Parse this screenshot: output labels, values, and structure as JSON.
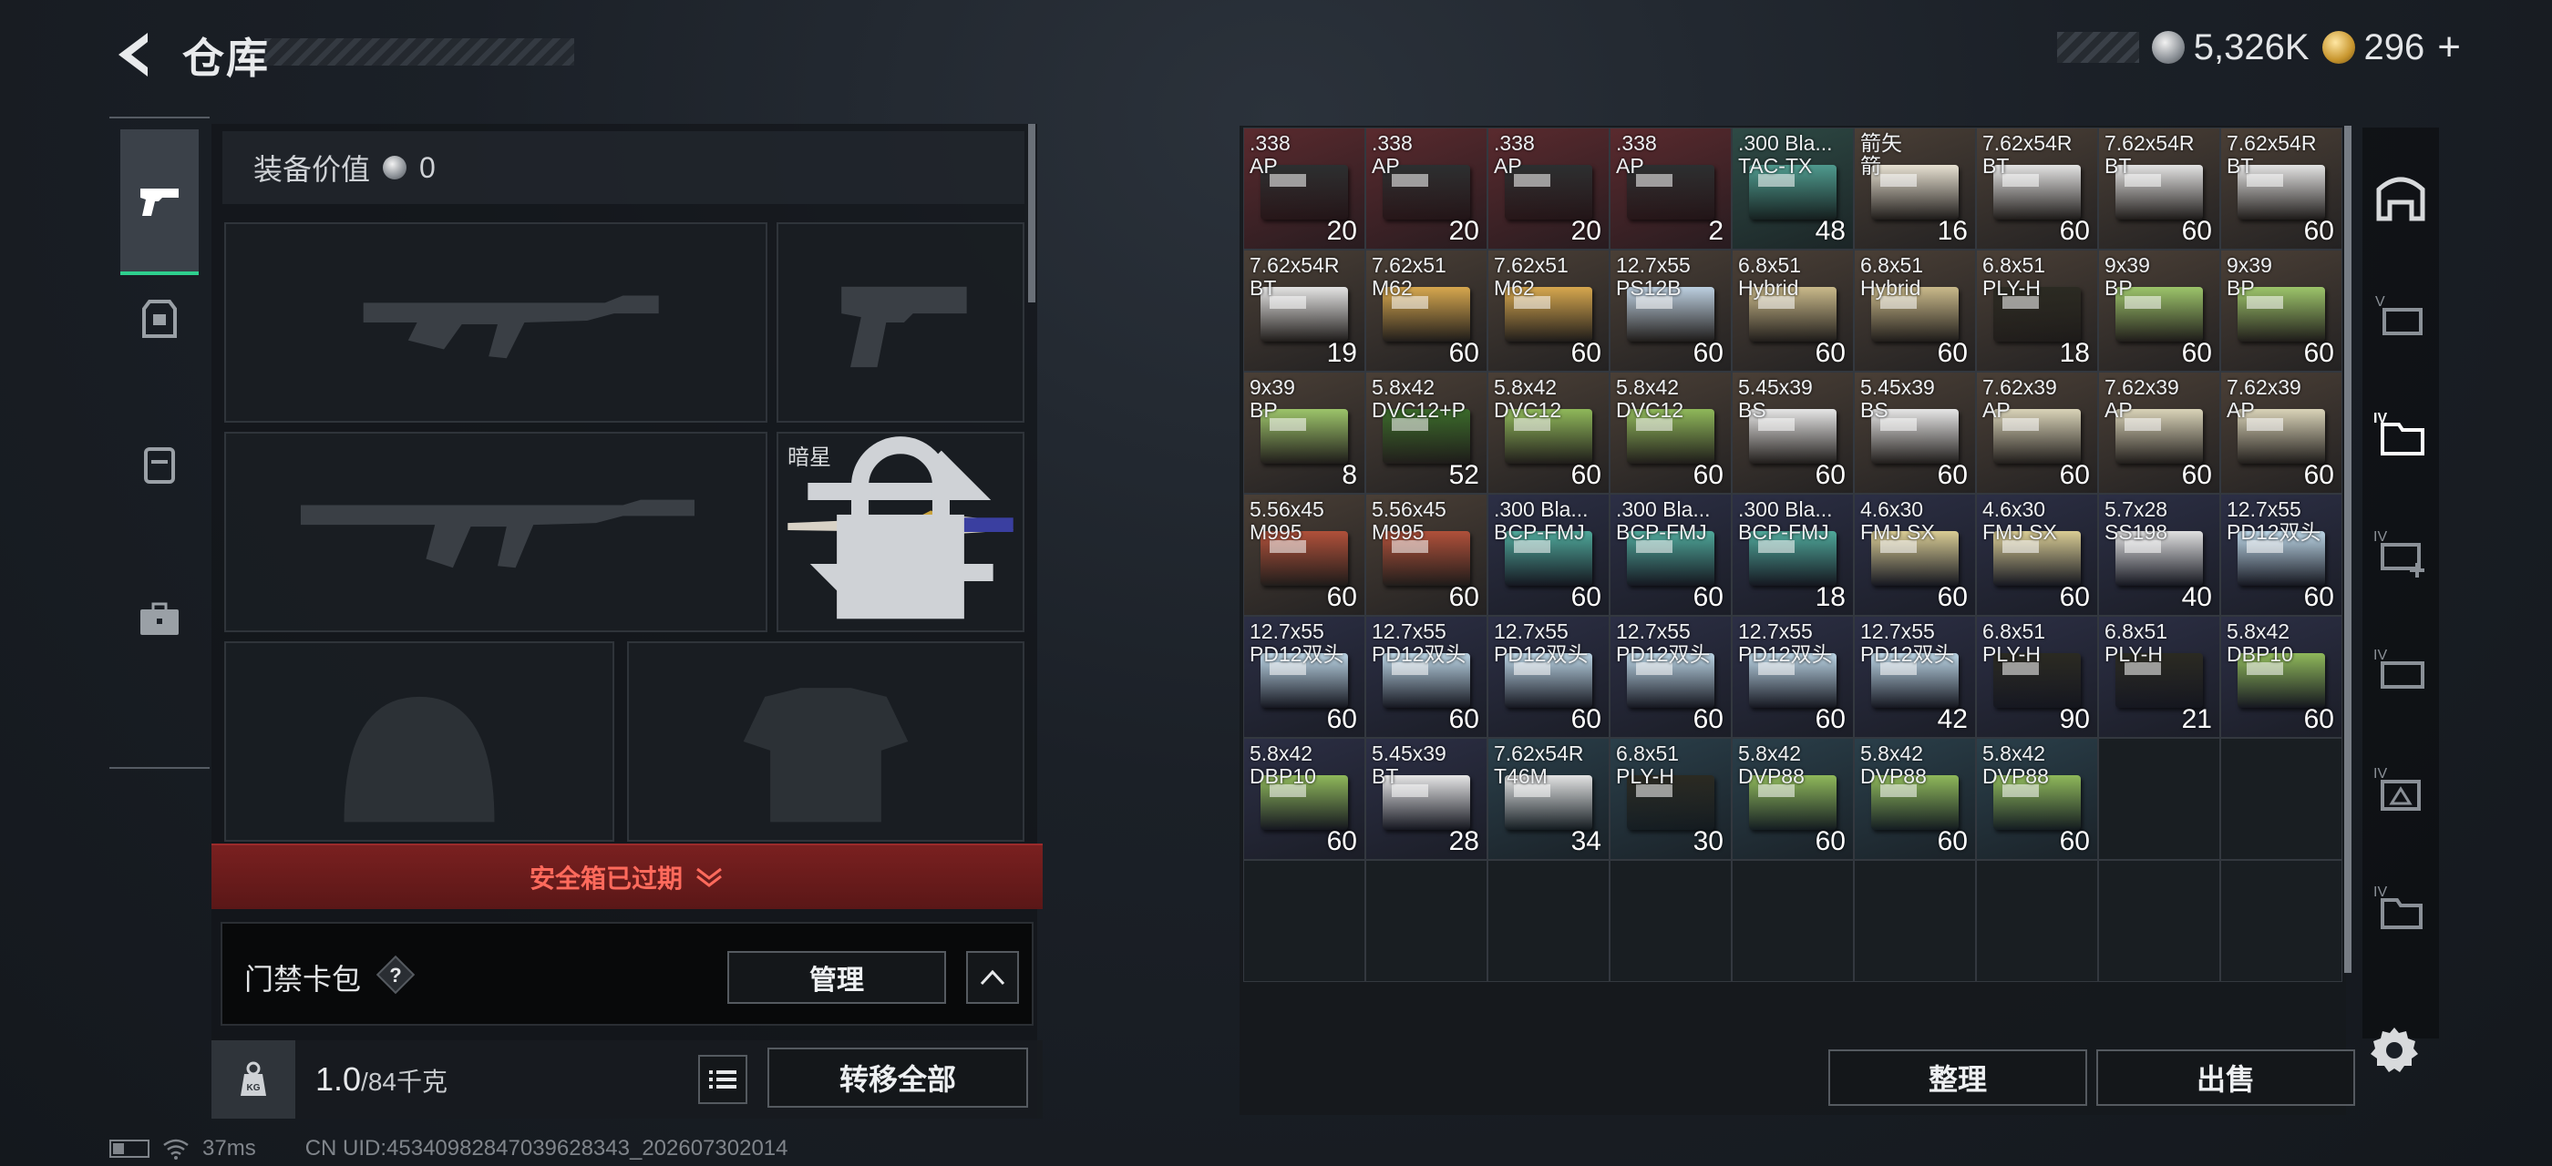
{
  "header": {
    "title": "仓库",
    "currency": {
      "silver": "5,326K",
      "gold": "296"
    }
  },
  "loadout": {
    "equip_value_label": "装备价值",
    "equip_value": "0",
    "knife_name": "暗星",
    "safe_box_expired": "安全箱已过期",
    "keycard_label": "门禁卡包",
    "help_symbol": "?",
    "manage_label": "管理",
    "weight_value": "1.0",
    "weight_capacity": "/84千克",
    "kg_badge": "KG",
    "transfer_all_label": "转移全部"
  },
  "storage": {
    "sort_label": "整理",
    "sell_label": "出售",
    "items": [
      {
        "name": ".338\nAP",
        "qty": "20",
        "bg": "#5a2a2e",
        "box": "#2c2f30"
      },
      {
        "name": ".338\nAP",
        "qty": "20",
        "bg": "#5a2a2e",
        "box": "#2c2f30"
      },
      {
        "name": ".338\nAP",
        "qty": "20",
        "bg": "#5a2a2e",
        "box": "#2c2f30"
      },
      {
        "name": ".338\nAP",
        "qty": "2",
        "bg": "#5a2a2e",
        "box": "#2c2f30"
      },
      {
        "name": ".300 Bla...\nTAC-TX",
        "qty": "48",
        "bg": "#2e4a45",
        "box": "#4f9a8e"
      },
      {
        "name": "箭矢\n箭",
        "qty": "16",
        "bg": "#4a3f36",
        "box": "#e7e1d2"
      },
      {
        "name": "7.62x54R\nBT",
        "qty": "60",
        "bg": "#4a3f36",
        "box": "#e3e3e3"
      },
      {
        "name": "7.62x54R\nBT",
        "qty": "60",
        "bg": "#4a3f36",
        "box": "#e3e3e3"
      },
      {
        "name": "7.62x54R\nBT",
        "qty": "60",
        "bg": "#4a3f36",
        "box": "#e3e3e3"
      },
      {
        "name": "7.62x54R\nBT",
        "qty": "19",
        "bg": "#4a3f36",
        "box": "#e3e3e3"
      },
      {
        "name": "7.62x51\nM62",
        "qty": "60",
        "bg": "#4a3f36",
        "box": "#d6a74e"
      },
      {
        "name": "7.62x51\nM62",
        "qty": "60",
        "bg": "#4a3f36",
        "box": "#d6a74e"
      },
      {
        "name": "12.7x55\nPS12B",
        "qty": "60",
        "bg": "#4a3f36",
        "box": "#bccfe0"
      },
      {
        "name": "6.8x51\nHybrid",
        "qty": "60",
        "bg": "#4a3f36",
        "box": "#c9b98a"
      },
      {
        "name": "6.8x51\nHybrid",
        "qty": "60",
        "bg": "#4a3f36",
        "box": "#c9b98a"
      },
      {
        "name": "6.8x51\nPLY-H",
        "qty": "18",
        "bg": "#4a3f36",
        "box": "#2b2a22"
      },
      {
        "name": "9x39\nBP",
        "qty": "60",
        "bg": "#4a3f36",
        "box": "#9cc46a"
      },
      {
        "name": "9x39\nBP",
        "qty": "60",
        "bg": "#4a3f36",
        "box": "#9cc46a"
      },
      {
        "name": "9x39\nBP",
        "qty": "8",
        "bg": "#4a3f36",
        "box": "#9cc46a"
      },
      {
        "name": "5.8x42\nDVC12+P",
        "qty": "52",
        "bg": "#4a3f36",
        "box": "#3a6a2a"
      },
      {
        "name": "5.8x42\nDVC12",
        "qty": "60",
        "bg": "#4a3f36",
        "box": "#8fb85a"
      },
      {
        "name": "5.8x42\nDVC12",
        "qty": "60",
        "bg": "#4a3f36",
        "box": "#8fb85a"
      },
      {
        "name": "5.45x39\nBS",
        "qty": "60",
        "bg": "#4a3f36",
        "box": "#e6e6e6"
      },
      {
        "name": "5.45x39\nBS",
        "qty": "60",
        "bg": "#4a3f36",
        "box": "#e6e6e6"
      },
      {
        "name": "7.62x39\nAP",
        "qty": "60",
        "bg": "#4a3f36",
        "box": "#d9d3b8"
      },
      {
        "name": "7.62x39\nAP",
        "qty": "60",
        "bg": "#4a3f36",
        "box": "#d9d3b8"
      },
      {
        "name": "7.62x39\nAP",
        "qty": "60",
        "bg": "#4a3f36",
        "box": "#d9d3b8"
      },
      {
        "name": "5.56x45\nM995",
        "qty": "60",
        "bg": "#4a3f36",
        "box": "#b0503a"
      },
      {
        "name": "5.56x45\nM995",
        "qty": "60",
        "bg": "#4a3f36",
        "box": "#b0503a"
      },
      {
        "name": ".300 Bla...\nBCP-FMJ",
        "qty": "60",
        "bg": "#2c2f45",
        "box": "#4fa89a"
      },
      {
        "name": ".300 Bla...\nBCP-FMJ",
        "qty": "60",
        "bg": "#2c2f45",
        "box": "#4fa89a"
      },
      {
        "name": ".300 Bla...\nBCP-FMJ",
        "qty": "18",
        "bg": "#2c2f45",
        "box": "#4fa89a"
      },
      {
        "name": "4.6x30\nFMJ SX",
        "qty": "60",
        "bg": "#2c2f45",
        "box": "#d9cc94"
      },
      {
        "name": "4.6x30\nFMJ SX",
        "qty": "60",
        "bg": "#2c2f45",
        "box": "#d9cc94"
      },
      {
        "name": "5.7x28\nSS198",
        "qty": "40",
        "bg": "#2c2f45",
        "box": "#e0e0e0"
      },
      {
        "name": "12.7x55\nPD12双头",
        "qty": "60",
        "bg": "#2c2f45",
        "box": "#bcd6e6"
      },
      {
        "name": "12.7x55\nPD12双头",
        "qty": "60",
        "bg": "#2c2f45",
        "box": "#bcd6e6"
      },
      {
        "name": "12.7x55\nPD12双头",
        "qty": "60",
        "bg": "#2c2f45",
        "box": "#bcd6e6"
      },
      {
        "name": "12.7x55\nPD12双头",
        "qty": "60",
        "bg": "#2c2f45",
        "box": "#bcd6e6"
      },
      {
        "name": "12.7x55\nPD12双头",
        "qty": "60",
        "bg": "#2c2f45",
        "box": "#bcd6e6"
      },
      {
        "name": "12.7x55\nPD12双头",
        "qty": "60",
        "bg": "#2c2f45",
        "box": "#bcd6e6"
      },
      {
        "name": "12.7x55\nPD12双头",
        "qty": "42",
        "bg": "#2c2f45",
        "box": "#bcd6e6"
      },
      {
        "name": "6.8x51\nPLY-H",
        "qty": "90",
        "bg": "#2c2f45",
        "box": "#2b2a22"
      },
      {
        "name": "6.8x51\nPLY-H",
        "qty": "21",
        "bg": "#2c2f45",
        "box": "#2b2a22"
      },
      {
        "name": "5.8x42\nDBP10",
        "qty": "60",
        "bg": "#2c2f45",
        "box": "#8fb85a"
      },
      {
        "name": "5.8x42\nDBP10",
        "qty": "60",
        "bg": "#2c2f45",
        "box": "#8fb85a"
      },
      {
        "name": "5.45x39\nBT",
        "qty": "28",
        "bg": "#2c2f45",
        "box": "#e6e6e6"
      },
      {
        "name": "7.62x54R\nT46M",
        "qty": "34",
        "bg": "#2a3f4a",
        "box": "#e3e3e3"
      },
      {
        "name": "6.8x51\nPLY-H",
        "qty": "30",
        "bg": "#2a3f4a",
        "box": "#2b2a22"
      },
      {
        "name": "5.8x42\nDVP88",
        "qty": "60",
        "bg": "#2a3f4a",
        "box": "#8fb85a"
      },
      {
        "name": "5.8x42\nDVP88",
        "qty": "60",
        "bg": "#2a3f4a",
        "box": "#8fb85a"
      },
      {
        "name": "5.8x42\nDVP88",
        "qty": "60",
        "bg": "#2a3f4a",
        "box": "#8fb85a"
      }
    ]
  },
  "status_bar": {
    "ping": "37ms",
    "uid": "CN UID:45340982847039628343_202607302014"
  }
}
